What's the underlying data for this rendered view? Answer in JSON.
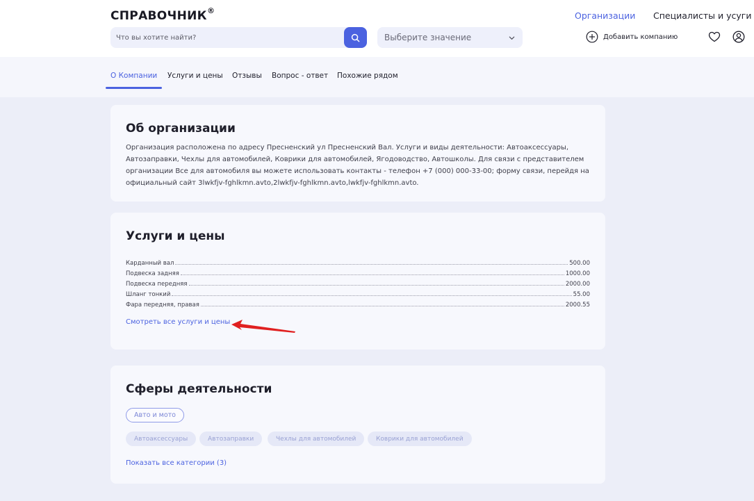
{
  "header": {
    "logo": "СПРАВОЧНИК",
    "logo_mark": "®",
    "search_placeholder": "Что вы хотите найти?",
    "select_label": "Выберите значение",
    "nav": {
      "organizations": "Организации",
      "specialists": "Специалисты и усуги"
    },
    "add_company": "Добавить компанию"
  },
  "tabs": [
    {
      "label": "О Компании",
      "active": true
    },
    {
      "label": "Услуги и цены",
      "active": false
    },
    {
      "label": "Отзывы",
      "active": false
    },
    {
      "label": "Вопрос - ответ",
      "active": false
    },
    {
      "label": "Похожие рядом",
      "active": false
    }
  ],
  "about": {
    "title": "Об организации",
    "text": "Организация расположена по адресу Пресненский ул Пресненский Вал. Услуги и виды деятельности: Автоаксессуары, Автозаправки, Чехлы для автомобилей, Коврики для автомобилей, Ягодоводство, Автошколы. Для связи с представителем организации Все для автомобиля вы можете использовать контакты - телефон +7 (000) 000-33-00; форму связи, перейдя на официальный сайт 3lwkfjv-fghlkmn.avto,2lwkfjv-fghlkmn.avto,lwkfjv-fghlkmn.avto."
  },
  "services": {
    "title": "Услуги и цены",
    "items": [
      {
        "name": "Карданный вал",
        "price": "500.00"
      },
      {
        "name": "Подвеска задняя",
        "price": "1000.00"
      },
      {
        "name": "Подвеска передняя",
        "price": "2000.00"
      },
      {
        "name": "Шланг тонкий",
        "price": "55.00"
      },
      {
        "name": "Фара передняя, правая",
        "price": "2000.55"
      }
    ],
    "link": "Смотреть все услуги и цены",
    "arrow_color": "#e02020"
  },
  "spheres": {
    "title": "Сферы деятельности",
    "main_chip": "Авто и мото",
    "chips": [
      "Автоаксессуары",
      "Автозаправки",
      "Чехлы для автомобилей",
      "Коврики для автомобилей"
    ],
    "link": "Показать все категории (3)"
  },
  "colors": {
    "accent": "#4b62e0",
    "background": "#eceef8",
    "card": "#f7f8fd"
  }
}
